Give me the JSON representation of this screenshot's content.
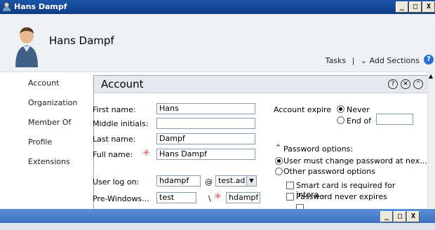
{
  "window": {
    "title": "Hans Dampf",
    "controls": {
      "min": "_",
      "max": "□",
      "close": "X"
    }
  },
  "header": {
    "user_name": "Hans Dampf",
    "tasks_label": "Tasks",
    "separator": "|",
    "add_sections_label": "Add Sections",
    "help_label": "?"
  },
  "nav": {
    "items": [
      {
        "label": "Account"
      },
      {
        "label": "Organization"
      },
      {
        "label": "Member Of"
      },
      {
        "label": "Profile"
      },
      {
        "label": "Extensions"
      }
    ]
  },
  "account": {
    "title": "Account",
    "first_name_label": "First name:",
    "first_name_value": "Hans",
    "middle_initials_label": "Middle initials:",
    "middle_initials_value": "",
    "last_name_label": "Last name:",
    "last_name_value": "Dampf",
    "full_name_label": "Full name:",
    "full_name_value": "Hans Dampf",
    "user_logon_label": "User log on:",
    "user_logon_value": "hdampf",
    "at_sign": "@",
    "domain_value": "test.ad",
    "pre_windows_label": "Pre-Windows...",
    "pre_windows_domain": "test",
    "backslash": "\\",
    "pre_windows_user": "hdampf",
    "account_expire_label": "Account expire",
    "never_label": "Never",
    "end_of_label": "End of",
    "password_options_label": "Password options:",
    "opt_must_change": "User must change password at nex...",
    "opt_other": "Other password options",
    "chk_smart_card": "Smart card is required for intera...",
    "chk_never_expires": "Password never expires"
  },
  "colors": {
    "titlebar": "#0d3d86",
    "required_star": "#e0404a",
    "header_bg": "#eff2f5"
  }
}
